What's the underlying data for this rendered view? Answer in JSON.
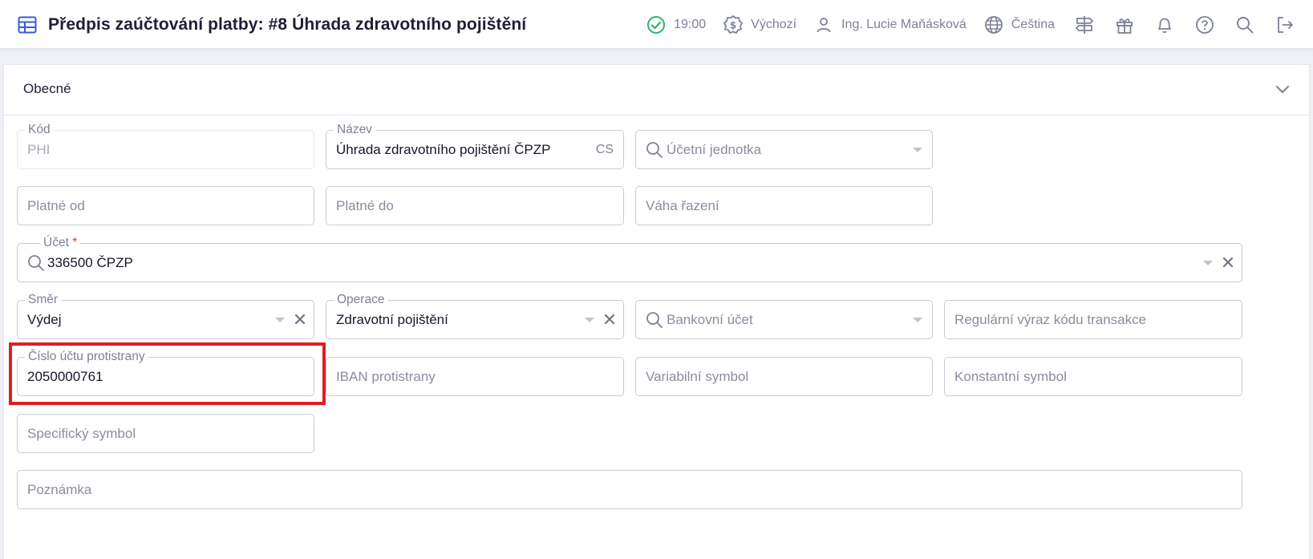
{
  "header": {
    "title": "Předpis zaúčtování platby: #8 Úhrada zdravotního pojištění",
    "status_time": "19:00",
    "currency_profile": "Výchozí",
    "user_name": "Ing. Lucie Maňásková",
    "language": "Čeština"
  },
  "section": {
    "title": "Obecné"
  },
  "form": {
    "kod": {
      "label": "Kód",
      "value": "PHI"
    },
    "nazev": {
      "label": "Název",
      "value": "Úhrada zdravotního pojištění ČPZP",
      "lang": "CS"
    },
    "ucetni_jednotka": {
      "placeholder": "Účetní jednotka"
    },
    "platne_od": {
      "placeholder": "Platné od"
    },
    "platne_do": {
      "placeholder": "Platné do"
    },
    "vaha_razeni": {
      "placeholder": "Váha řazení"
    },
    "ucet": {
      "label": "Účet",
      "required_mark": "*",
      "value": "336500 ČPZP"
    },
    "smer": {
      "label": "Směr",
      "value": "Výdej"
    },
    "operace": {
      "label": "Operace",
      "value": "Zdravotní pojištění"
    },
    "bankovni_ucet": {
      "placeholder": "Bankovní účet"
    },
    "regex_kodu": {
      "placeholder": "Regulární výraz kódu transakce"
    },
    "cislo_uctu_protistrany": {
      "label": "Číslo účtu protistrany",
      "value": "2050000761"
    },
    "iban_protistrany": {
      "placeholder": "IBAN protistrany"
    },
    "variabilni_symbol": {
      "placeholder": "Variabilní symbol"
    },
    "konstantni_symbol": {
      "placeholder": "Konstantní symbol"
    },
    "specificky_symbol": {
      "placeholder": "Specifický symbol"
    },
    "poznamka": {
      "placeholder": "Poznámka"
    }
  },
  "colors": {
    "accent": "#3b5bdb",
    "status_ok": "#2fb36b",
    "highlight": "#e01e1e",
    "required": "#d33a3a"
  },
  "icons": {
    "title": "table-icon",
    "status": "check-circle-icon",
    "currency": "dollar-badge-icon",
    "user": "user-icon",
    "language": "globe-icon",
    "extra": [
      "signpost-icon",
      "gift-icon",
      "bell-icon",
      "help-icon",
      "search-icon",
      "logout-icon"
    ]
  }
}
